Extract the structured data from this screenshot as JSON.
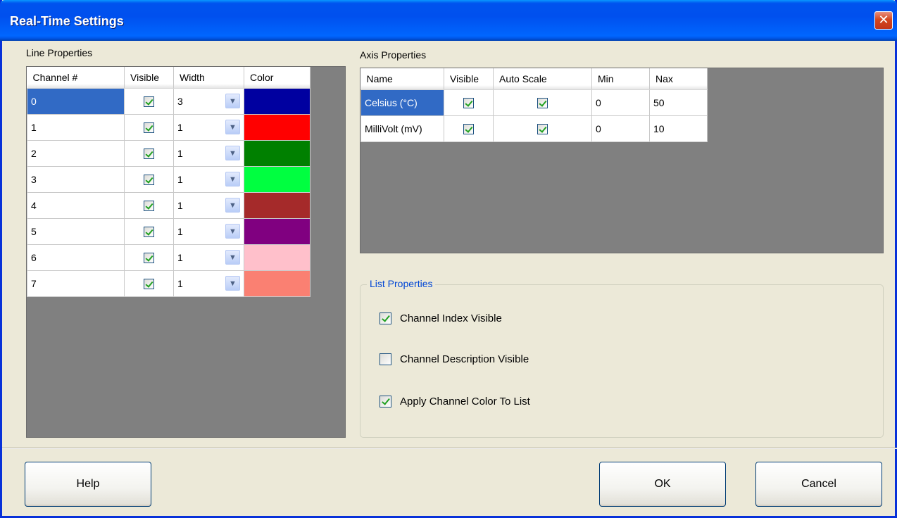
{
  "window": {
    "title": "Real-Time Settings",
    "close_glyph": "✕"
  },
  "line_properties": {
    "label": "Line Properties",
    "columns": [
      "Channel #",
      "Visible",
      "Width",
      "Color"
    ],
    "rows": [
      {
        "channel": "0",
        "visible": true,
        "width": "3",
        "color": "#0000a0",
        "selected": true
      },
      {
        "channel": "1",
        "visible": true,
        "width": "1",
        "color": "#ff0000"
      },
      {
        "channel": "2",
        "visible": true,
        "width": "1",
        "color": "#008000"
      },
      {
        "channel": "3",
        "visible": true,
        "width": "1",
        "color": "#00ff40"
      },
      {
        "channel": "4",
        "visible": true,
        "width": "1",
        "color": "#a52a2a"
      },
      {
        "channel": "5",
        "visible": true,
        "width": "1",
        "color": "#800080"
      },
      {
        "channel": "6",
        "visible": true,
        "width": "1",
        "color": "#ffc0cb"
      },
      {
        "channel": "7",
        "visible": true,
        "width": "1",
        "color": "#fa8072"
      }
    ]
  },
  "axis_properties": {
    "label": "Axis Properties",
    "columns": [
      "Name",
      "Visible",
      "Auto Scale",
      "Min",
      "Nax"
    ],
    "rows": [
      {
        "name": "Celsius (°C)",
        "visible": true,
        "auto_scale": true,
        "min": "0",
        "max": "50",
        "selected": true
      },
      {
        "name": "MilliVolt (mV)",
        "visible": true,
        "auto_scale": true,
        "min": "0",
        "max": "10"
      }
    ]
  },
  "list_properties": {
    "label": "List Properties",
    "options": [
      {
        "label": "Channel Index Visible",
        "checked": true
      },
      {
        "label": "Channel Description Visible",
        "checked": false
      },
      {
        "label": "Apply Channel Color To List",
        "checked": true
      }
    ]
  },
  "buttons": {
    "help": "Help",
    "ok": "OK",
    "cancel": "Cancel"
  },
  "colors": {
    "title_bar": "#0054e3",
    "selection": "#316ac5",
    "group_title": "#0046d5",
    "grid_background": "#808080"
  }
}
